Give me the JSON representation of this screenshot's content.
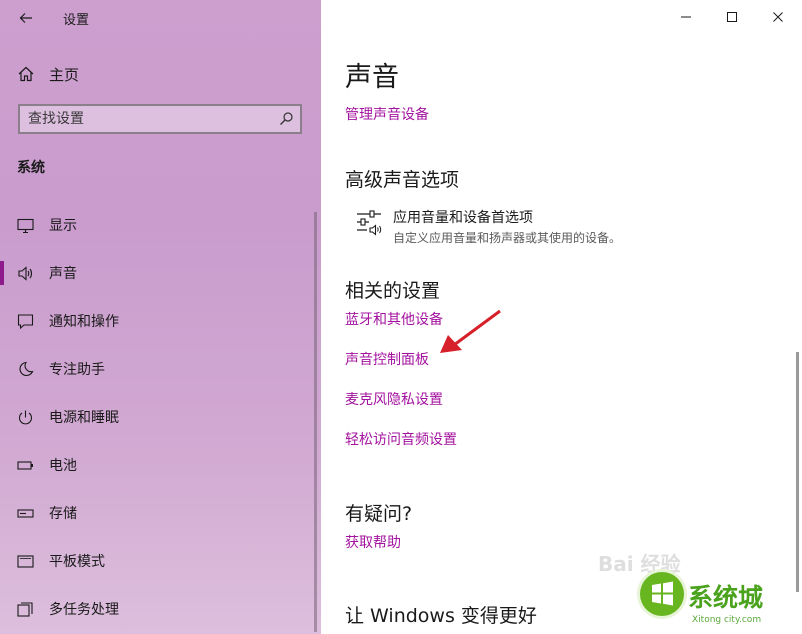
{
  "titlebar": {
    "back_icon": "arrow-left-icon",
    "app_title": "设置"
  },
  "window_controls": {
    "minimize_icon": "minimize-icon",
    "maximize_icon": "maximize-icon",
    "close_icon": "close-icon"
  },
  "sidebar": {
    "home_label": "主页",
    "search_placeholder": "查找设置",
    "section_title": "系统",
    "items": [
      {
        "label": "显示",
        "icon": "monitor-icon"
      },
      {
        "label": "声音",
        "icon": "speaker-icon",
        "active": true
      },
      {
        "label": "通知和操作",
        "icon": "notification-icon"
      },
      {
        "label": "专注助手",
        "icon": "moon-icon"
      },
      {
        "label": "电源和睡眠",
        "icon": "power-icon"
      },
      {
        "label": "电池",
        "icon": "battery-icon"
      },
      {
        "label": "存储",
        "icon": "storage-icon"
      },
      {
        "label": "平板模式",
        "icon": "tablet-icon"
      },
      {
        "label": "多任务处理",
        "icon": "multitasking-icon"
      }
    ]
  },
  "main": {
    "title": "声音",
    "manage_link": "管理声音设备",
    "advanced": {
      "heading": "高级声音选项",
      "item_title": "应用音量和设备首选项",
      "item_desc": "自定义应用音量和扬声器或其使用的设备。"
    },
    "related": {
      "heading": "相关的设置",
      "links": [
        "蓝牙和其他设备",
        "声音控制面板",
        "麦克风隐私设置",
        "轻松访问音频设置"
      ]
    },
    "question": {
      "heading": "有疑问?",
      "link": "获取帮助"
    },
    "improve_heading": "让 Windows 变得更好"
  },
  "watermark": {
    "brand": "系统城",
    "url": "Xitong city.com",
    "faint": "Bai 经验"
  },
  "colors": {
    "accent_link": "#a3139f",
    "active_bar": "#8e1b8e",
    "sidebar_tint": "#cd9fcf",
    "annotation_arrow": "#d6202a"
  }
}
